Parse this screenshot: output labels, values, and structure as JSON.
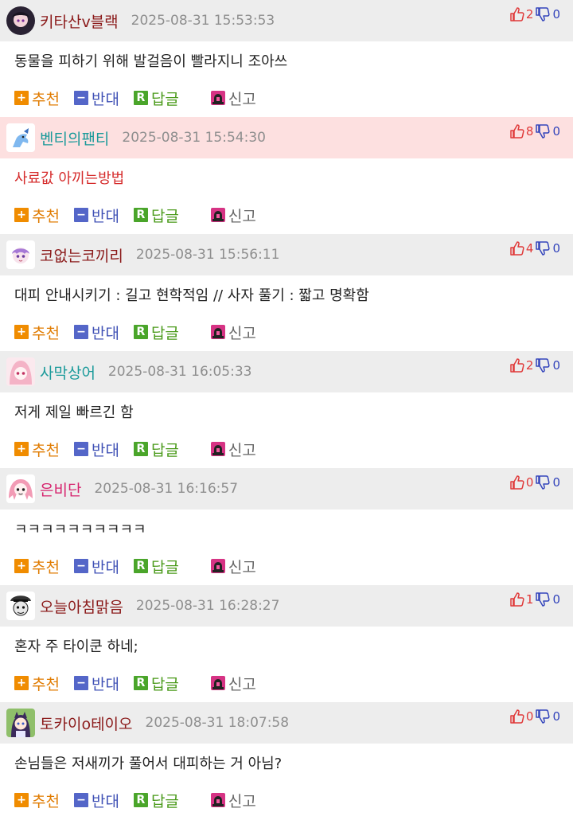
{
  "colors": {
    "header_bg": "#ededed",
    "header_highlight_bg": "#fde0e0",
    "recommend": "#e07b00",
    "oppose": "#3f51b5",
    "reply": "#4a9a1a",
    "report": "#d63384",
    "upvote": "#e03a3a",
    "downvote": "#3344bb"
  },
  "actions": {
    "recommend_label": "추천",
    "recommend_icon": "+",
    "oppose_label": "반대",
    "oppose_icon": "−",
    "reply_label": "답글",
    "reply_icon": "R",
    "report_label": "신고"
  },
  "comments": [
    {
      "nickname": "키타산v블랙",
      "nick_color": "#8b1a1a",
      "timestamp": "2025-08-31 15:53:53",
      "up": "2",
      "down": "0",
      "text": "동물을 피하기 위해 발걸음이 빨라지니 조아쓰",
      "highlight": false,
      "text_red": false,
      "avatar_icon": "dark-character-avatar-icon"
    },
    {
      "nickname": "벤티의팬티",
      "nick_color": "#1a9a9a",
      "timestamp": "2025-08-31 15:54:30",
      "up": "8",
      "down": "0",
      "text": "사료값 아끼는방법",
      "highlight": true,
      "text_red": true,
      "avatar_icon": "pony-avatar-icon"
    },
    {
      "nickname": "코없는코끼리",
      "nick_color": "#8b1a1a",
      "timestamp": "2025-08-31 15:56:11",
      "up": "4",
      "down": "0",
      "text": "대피 안내시키기 : 길고 현학적임 // 사자 풀기 : 짧고 명확함",
      "highlight": false,
      "text_red": false,
      "avatar_icon": "purple-character-avatar-icon"
    },
    {
      "nickname": "사막상어",
      "nick_color": "#1a9a9a",
      "timestamp": "2025-08-31 16:05:33",
      "up": "2",
      "down": "0",
      "text": "저게 제일 빠르긴 함",
      "highlight": false,
      "text_red": false,
      "avatar_icon": "pink-hair-avatar-icon"
    },
    {
      "nickname": "은비단",
      "nick_color": "#d6246e",
      "timestamp": "2025-08-31 16:16:57",
      "up": "0",
      "down": "0",
      "text": "ㅋㅋㅋㅋㅋㅋㅋㅋㅋㅋ",
      "highlight": false,
      "text_red": false,
      "avatar_icon": "pink-twintail-avatar-icon"
    },
    {
      "nickname": "오늘아침맑음",
      "nick_color": "#8b1a1a",
      "timestamp": "2025-08-31 16:28:27",
      "up": "1",
      "down": "0",
      "text": "혼자 주 타이쿤 하네;",
      "highlight": false,
      "text_red": false,
      "avatar_icon": "mono-face-avatar-icon"
    },
    {
      "nickname": "토카이o테이오",
      "nick_color": "#8b1a1a",
      "timestamp": "2025-08-31 18:07:58",
      "up": "0",
      "down": "0",
      "text": "손님들은 저새끼가 풀어서 대피하는 거 아님?",
      "highlight": false,
      "text_red": false,
      "avatar_icon": "horse-girl-avatar-icon"
    }
  ]
}
